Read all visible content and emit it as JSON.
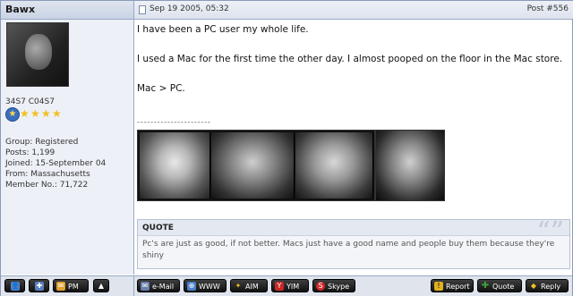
{
  "header": {
    "username": "Bawx",
    "date": "Sep 19 2005, 05:32",
    "post_number": "Post #556"
  },
  "profile": {
    "rank": "34S7 C04S7",
    "group": "Group: Registered",
    "posts": "Posts: 1,199",
    "joined": "Joined: 15-September 04",
    "from": "From: Massachusetts",
    "member_no": "Member No.: 71,722"
  },
  "post": {
    "line1": "I have been a PC user my whole life.",
    "line2": "I used a Mac for the first time the other day. I almost pooped on the floor in the Mac store.",
    "line3": "Mac > PC.",
    "signature_rule": "----------------------"
  },
  "quote": {
    "title": "QUOTE",
    "text": "Pc's are just as good, if not better. Macs just have a good name and people buy them because they're shiny"
  },
  "buttons": {
    "pm": "PM",
    "email": "e-Mail",
    "www": "WWW",
    "aim": "AIM",
    "yim": "YIM",
    "skype": "Skype",
    "report": "Report",
    "quote": "Quote",
    "reply": "Reply"
  },
  "colors": {
    "header_bg": "#c9d3e4",
    "sidebar_bg": "#edf0f6",
    "button_bg": "#1a1a1a",
    "accent_red": "#d42b2b",
    "accent_green": "#3aa23a"
  }
}
